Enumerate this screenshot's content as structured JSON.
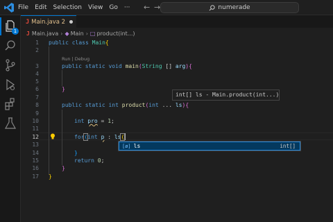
{
  "menu": [
    "File",
    "Edit",
    "Selection",
    "View",
    "Go",
    "···"
  ],
  "command_center": {
    "label": "numerade"
  },
  "activity_badge": "1",
  "tab": {
    "icon": "J",
    "label": "Main.java 2"
  },
  "breadcrumb": {
    "file_icon": "J",
    "file": "Main.java",
    "class": "Main",
    "method": "product(int...)"
  },
  "line_numbers": [
    "1",
    "2",
    "3",
    "4",
    "5",
    "6",
    "7",
    "8",
    "9",
    "10",
    "11",
    "12",
    "13",
    "14",
    "15",
    "16",
    "17"
  ],
  "codelens": "Run | Debug",
  "code": {
    "l1": {
      "kw1": "public",
      "kw2": "class",
      "cls": "Main",
      "br": "{"
    },
    "l3": {
      "kw1": "public",
      "kw2": "static",
      "kw3": "void",
      "fn": "main",
      "p1": "(",
      "typ": "String",
      "arr": " [] ",
      "var": "arg",
      "p2": ")",
      "br": "{"
    },
    "l5": {
      "br": "}"
    },
    "l7": {
      "kw1": "public",
      "kw2": "static",
      "kw3": "int",
      "fn": "product",
      "p1": "(",
      "kw4": "int",
      "dots": " ... ",
      "var": "ls",
      "p2": ")",
      "br": "{"
    },
    "l9": {
      "kw": "int",
      "var": "pro",
      "eq": " = ",
      "num": "1",
      "semi": ";"
    },
    "l11": {
      "kw1": "for",
      "p1": "(",
      "kw2": "int",
      "var1": "p",
      "col": " : ",
      "var2": "ls",
      "p2": "("
    },
    "l13": {
      "br": "}"
    },
    "l14": {
      "kw": "return",
      "num": "0",
      "semi": ";"
    },
    "l15": {
      "br": "}"
    },
    "l16": {
      "br": "}"
    }
  },
  "hover": {
    "text": "int[] ls - Main.product(int...)"
  },
  "suggest": {
    "icon": "[ø]",
    "label": "ls",
    "detail": "int[]"
  }
}
